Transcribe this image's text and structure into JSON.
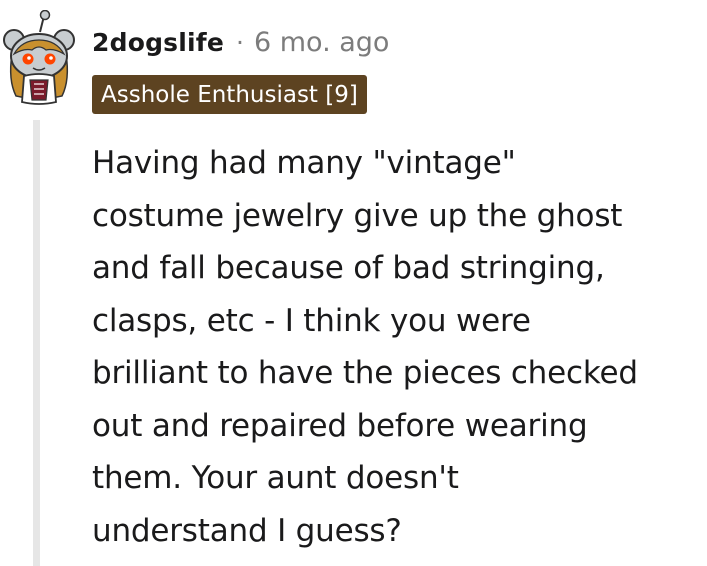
{
  "comment": {
    "username": "2dogslife",
    "separator": "·",
    "timestamp": "6 mo. ago",
    "flair": "Asshole Enthusiast [9]",
    "body_lines": [
      "Having had many \"vintage\"",
      "costume jewelry give up the ghost",
      "and fall because of bad stringing,",
      "clasps, etc - I think you were",
      "brilliant to have the pieces checked",
      "out and repaired before wearing",
      "them. Your aunt doesn't",
      "understand I guess?"
    ]
  },
  "colors": {
    "username": "#1a1a1b",
    "meta": "#7c7c7c",
    "flair_background": "#5d4321",
    "flair_text": "#ffffff",
    "thread_line": "#e6e6e6",
    "avatar_head": "#c8cdd0",
    "avatar_hair": "#c9902e"
  }
}
